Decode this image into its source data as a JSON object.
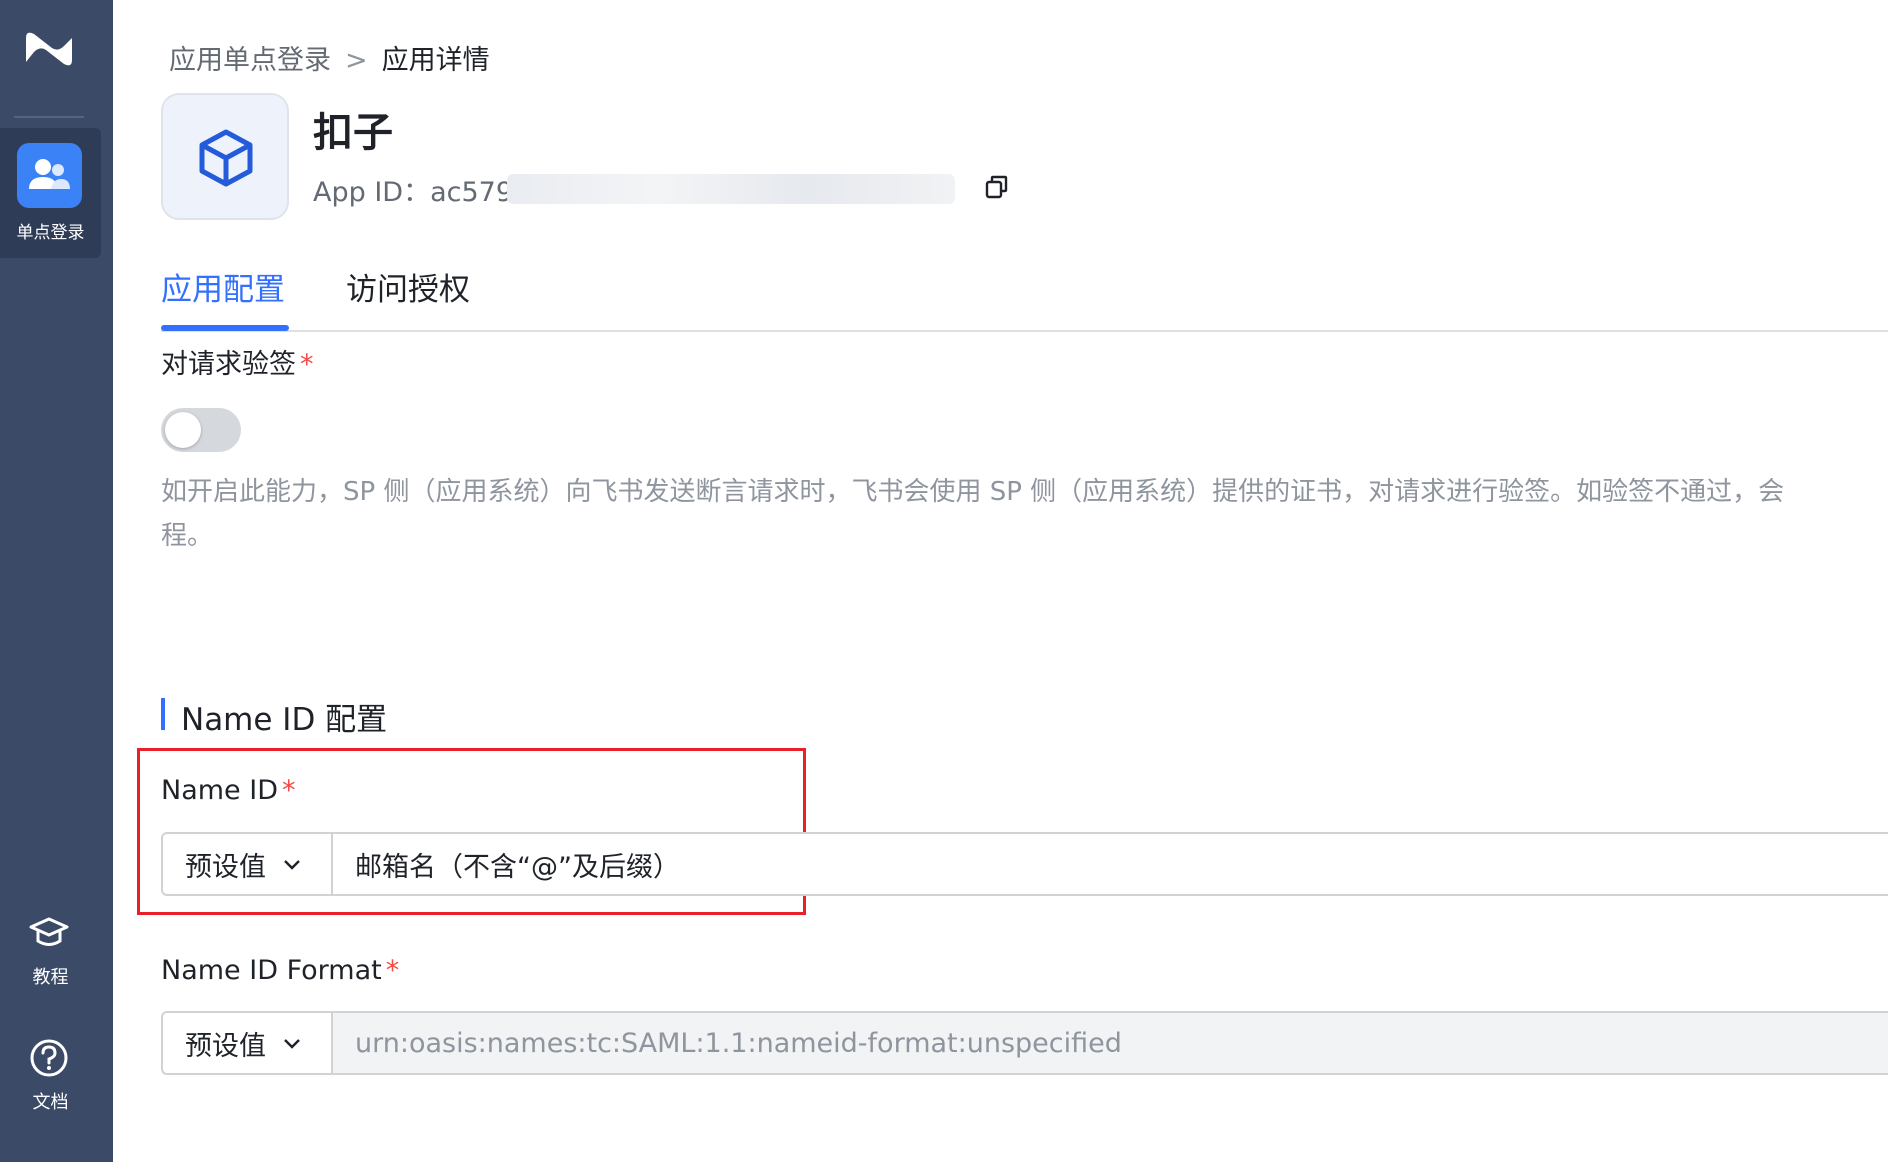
{
  "sidebar": {
    "items": [
      {
        "label": "单点登录",
        "icon": "users-icon",
        "active": true
      },
      {
        "label": "教程",
        "icon": "graduation-cap-icon"
      },
      {
        "label": "文档",
        "icon": "help-circle-icon"
      }
    ]
  },
  "breadcrumb": {
    "parent": "应用单点登录",
    "separator": ">",
    "current": "应用详情"
  },
  "app": {
    "name": "扣子",
    "id_label": "App ID：",
    "id_visible_prefix": "ac579"
  },
  "tabs": [
    {
      "label": "应用配置",
      "active": true
    },
    {
      "label": "访问授权",
      "active": false
    }
  ],
  "signature_verification": {
    "label": "对请求验签",
    "required_mark": "*",
    "enabled": false,
    "description_line1": "如开启此能力，SP 侧（应用系统）向飞书发送断言请求时，飞书会使用 SP 侧（应用系统）提供的证书，对请求进行验签。如验签不通过，会",
    "description_line2": "程。"
  },
  "name_id_section": {
    "title": "Name ID 配置",
    "name_id": {
      "label": "Name ID",
      "required_mark": "*",
      "mode": "预设值",
      "value": "邮箱名（不含“@”及后缀）"
    },
    "name_id_format": {
      "label": "Name ID Format",
      "required_mark": "*",
      "mode": "预设值",
      "value": "urn:oasis:names:tc:SAML:1.1:nameid-format:unspecified"
    }
  },
  "colors": {
    "sidebar_bg": "#3b4a66",
    "accent": "#3370ff",
    "required": "#f54a45",
    "highlight_border": "#e8202a"
  }
}
